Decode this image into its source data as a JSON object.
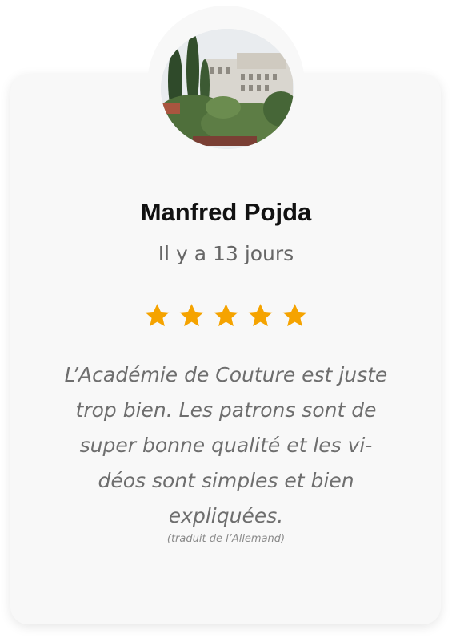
{
  "reviewer": {
    "name": "Manfred Pojda",
    "time_ago": "Il y a 13 jours",
    "avatar": "photo-avatar"
  },
  "rating": {
    "value": 5,
    "max": 5,
    "star_color": "#f5a300",
    "icon": "star-icon"
  },
  "review": {
    "text": "L’Académie de Couture est juste trop bien. Les patrons sont de super bonne qualité et les vi-déos sont simples et bien expliquées.",
    "translation_note": "(traduit de l’Allemand)"
  }
}
